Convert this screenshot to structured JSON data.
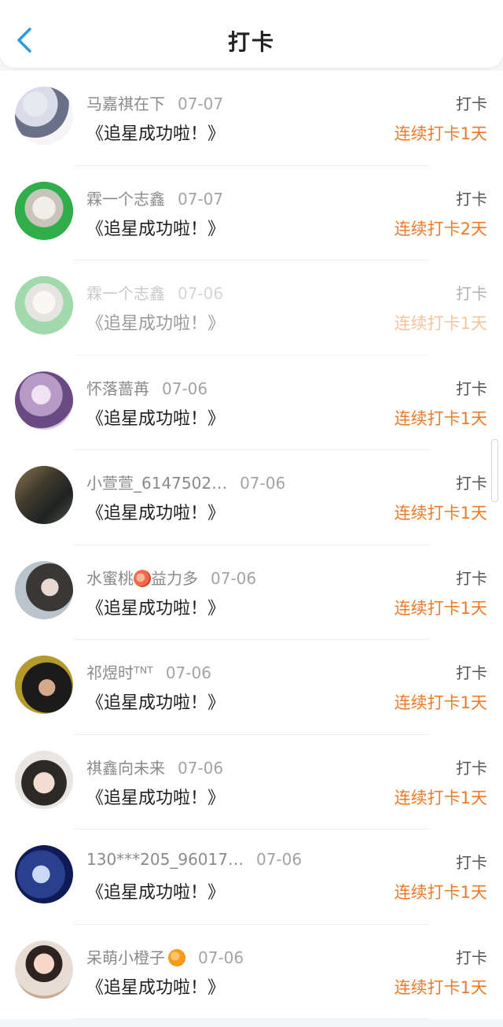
{
  "header": {
    "title": "打卡"
  },
  "rows": [
    {
      "name": "马嘉祺在下",
      "date": "07-07",
      "message": "《追星成功啦！》",
      "action": "打卡",
      "streak": "连续打卡1天"
    },
    {
      "name": "霖一个志鑫",
      "date": "07-07",
      "message": "《追星成功啦！》",
      "action": "打卡",
      "streak": "连续打卡2天"
    },
    {
      "name": "霖一个志鑫",
      "date": "07-06",
      "message": "《追星成功啦！》",
      "action": "打卡",
      "streak": "连续打卡1天"
    },
    {
      "name": "怀落蔷苒",
      "date": "07-06",
      "message": "《追星成功啦！》",
      "action": "打卡",
      "streak": "连续打卡1天"
    },
    {
      "name": "小萱萱_6147502…",
      "date": "07-06",
      "message": "《追星成功啦！》",
      "action": "打卡",
      "streak": "连续打卡1天"
    },
    {
      "name": "水蜜桃",
      "name_suffix": "益力多",
      "date": "07-06",
      "message": "《追星成功啦！》",
      "action": "打卡",
      "streak": "连续打卡1天"
    },
    {
      "name": "祁煜时ᵀᴺᵀ",
      "date": "07-06",
      "message": "《追星成功啦！》",
      "action": "打卡",
      "streak": "连续打卡1天"
    },
    {
      "name": "祺鑫向未来",
      "date": "07-06",
      "message": "《追星成功啦！》",
      "action": "打卡",
      "streak": "连续打卡1天"
    },
    {
      "name": "130***205_96017…",
      "date": "07-06",
      "message": "《追星成功啦！》",
      "action": "打卡",
      "streak": "连续打卡1天"
    },
    {
      "name": "呆萌小橙子",
      "date": "07-06",
      "message": "《追星成功啦！》",
      "action": "打卡",
      "streak": "连续打卡1天"
    }
  ],
  "colors": {
    "accent": "#2a9bf0",
    "streak": "#ee7a27"
  },
  "icons": {
    "back": "chevron-left-icon",
    "peach": "peach-emoji-icon",
    "orange": "orange-emoji-icon"
  }
}
